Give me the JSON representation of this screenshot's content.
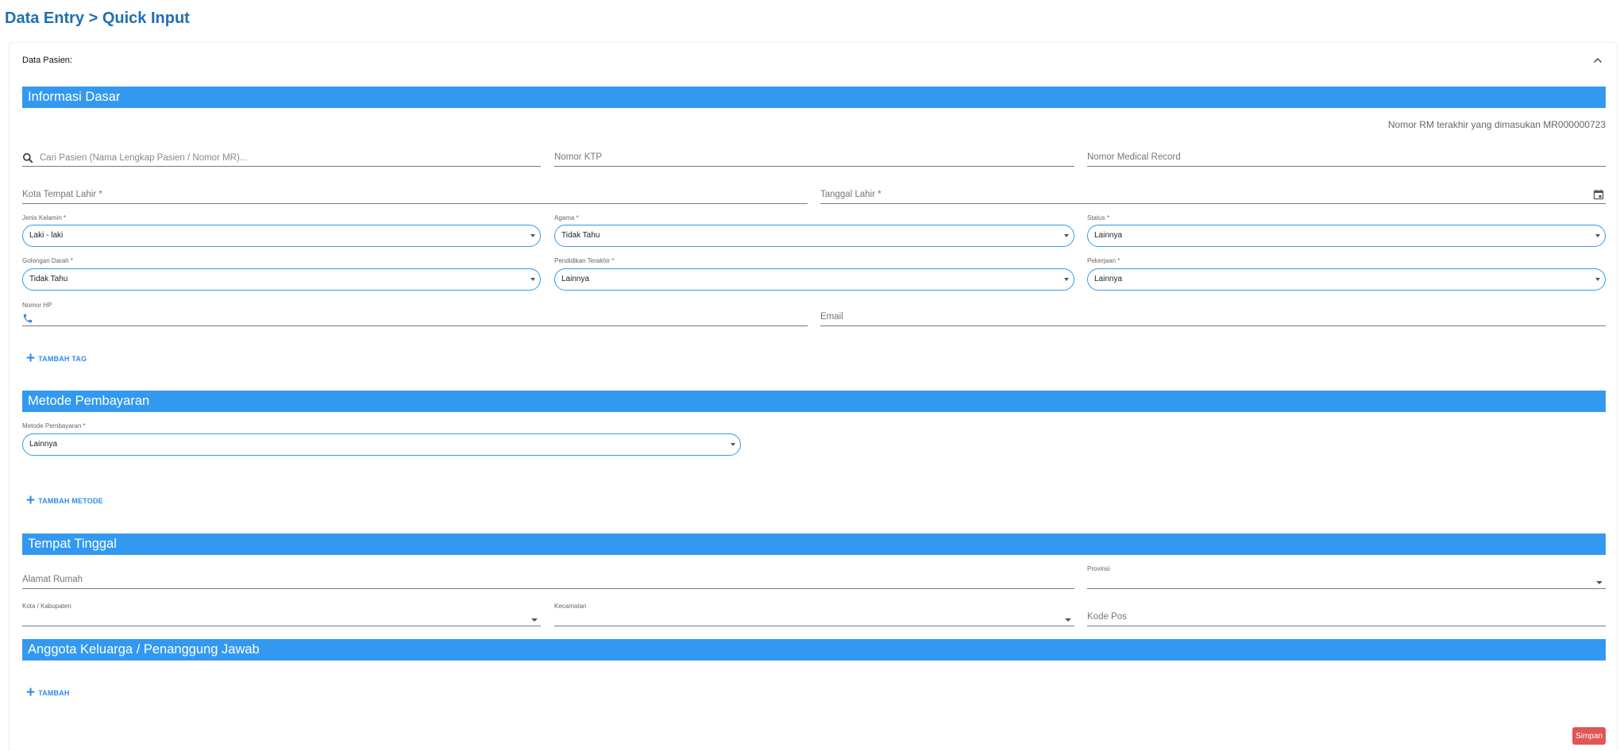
{
  "page": {
    "title": "Data Entry > Quick Input"
  },
  "card": {
    "header_label": "Data Pasien:"
  },
  "sections": {
    "basic": "Informasi Dasar",
    "payment": "Metode Pembayaran",
    "residence": "Tempat Tinggal",
    "family": "Anggota Keluarga / Penanggung Jawab"
  },
  "basic_info": {
    "last_rm_text": "Nomor RM terakhir yang dimasukan MR000000723",
    "search_placeholder": "Cari Pasien (Nama Lengkap Pasien / Nomor MR)...",
    "ktp_label": "Nomor KTP",
    "mr_label": "Nomor Medical Record",
    "birth_city_label": "Kota Tempat Lahir *",
    "birth_date_label": "Tanggal Lahir *",
    "gender": {
      "label": "Jenis Kelamin *",
      "value": "Laki - laki"
    },
    "religion": {
      "label": "Agama *",
      "value": "Tidak Tahu"
    },
    "status": {
      "label": "Status *",
      "value": "Lainnya"
    },
    "blood_type": {
      "label": "Golongan Darah *",
      "value": "Tidak Tahu"
    },
    "education": {
      "label": "Pendidikan Terakhir *",
      "value": "Lainnya"
    },
    "occupation": {
      "label": "Pekerjaan *",
      "value": "Lainnya"
    },
    "phone_label": "Nomor HP",
    "email_label": "Email",
    "add_tag_label": "TAMBAH TAG"
  },
  "payment": {
    "method": {
      "label": "Metode Pembayaran *",
      "value": "Lainnya"
    },
    "add_method_label": "TAMBAH METODE"
  },
  "residence": {
    "address_label": "Alamat Rumah",
    "province_label": "Provinsi",
    "city_label": "Kota / Kabupaten",
    "district_label": "Kecamatan",
    "postal_label": "Kode Pos"
  },
  "family": {
    "add_label": "TAMBAH"
  },
  "actions": {
    "save_label": "Simpan"
  },
  "colors": {
    "primary": "#3399f0",
    "title": "#1f6fb2",
    "save": "#e05555"
  },
  "icons": [
    "chevron-up-icon",
    "search-icon",
    "calendar-icon",
    "phone-icon",
    "plus-icon",
    "caret-down-icon"
  ]
}
